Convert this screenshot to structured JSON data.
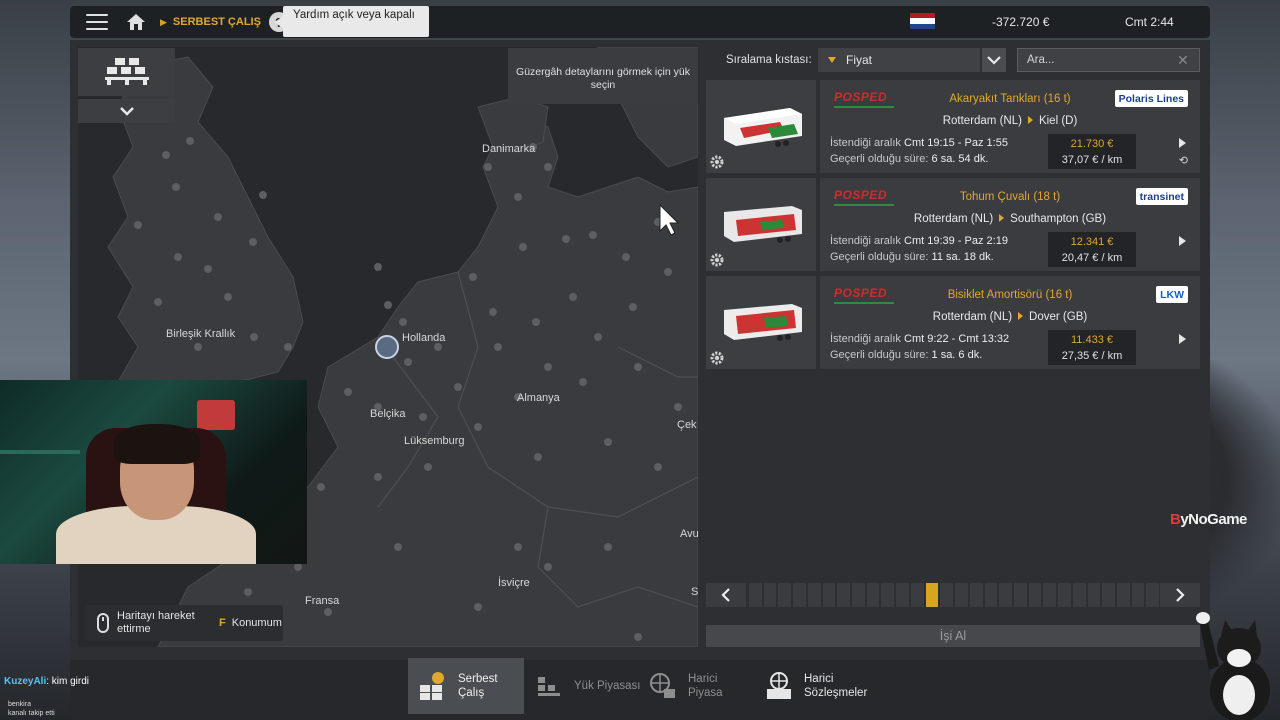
{
  "topbar": {
    "breadcrumb": "SERBEST ÇALIŞ",
    "help_symbol": "?",
    "help_tooltip": "Yardım açık veya kapalı",
    "money": "-372.720 €",
    "time": "Cmt 2:44",
    "flag": [
      "#ae1c28",
      "#ffffff",
      "#21468b"
    ]
  },
  "map": {
    "route_hint": "Güzergâh detaylarını görmek için yük seçin",
    "labels": {
      "denmark": "Danimarka",
      "uk": "Birleşik Krallık",
      "netherlands": "Hollanda",
      "belgium": "Belçika",
      "luxembourg": "Lüksemburg",
      "germany": "Almanya",
      "france": "Fransa",
      "switzerland": "İsviçre",
      "czech": "Çek",
      "austria": "Avu",
      "slovenia": "S"
    },
    "move_hint": "Haritayı hareket ettirme",
    "location_key": "F",
    "location_label": "Konumum"
  },
  "sort": {
    "label": "Sıralama kıstası:",
    "value": "Fiyat",
    "search_placeholder": "Ara..."
  },
  "jobs": [
    {
      "sender": "POSPED",
      "cargo": "Akaryakıt Tankları (16 t)",
      "company": "Polaris Lines",
      "company_color": "#1b3f91",
      "from": "Rotterdam (NL)",
      "to": "Kiel (D)",
      "window_label": "İstendiği aralık",
      "window": "Cmt 19:15 - Paz 1:55",
      "valid_label": "Geçerli olduğu süre:",
      "valid": "6 sa. 54 dk.",
      "price": "21.730 €",
      "rate": "37,07 € / km"
    },
    {
      "sender": "POSPED",
      "cargo": "Tohum Çuvalı (18 t)",
      "company": "transinet",
      "company_color": "#1c3f8c",
      "from": "Rotterdam (NL)",
      "to": "Southampton (GB)",
      "window_label": "İstendiği aralık",
      "window": "Cmt 19:39 - Paz 2:19",
      "valid_label": "Geçerli olduğu süre:",
      "valid": "11 sa. 18 dk.",
      "price": "12.341 €",
      "rate": "20,47 € / km"
    },
    {
      "sender": "POSPED",
      "cargo": "Bisiklet Amortisörü (16 t)",
      "company": "LKW",
      "company_color": "#1a5cc8",
      "from": "Rotterdam (NL)",
      "to": "Dover (GB)",
      "window_label": "İstendiği aralık",
      "window": "Cmt 9:22 - Cmt 13:32",
      "valid_label": "Geçerli olduğu süre:",
      "valid": "1 sa. 6 dk.",
      "price": "11.433 €",
      "rate": "27,35 € / km"
    }
  ],
  "pager": {
    "active_page": 13,
    "total_pages": 28
  },
  "take_job": "İşi Al",
  "tabs": [
    {
      "label": "Serbest\nÇalış",
      "icon": "freelance-icon",
      "active": true
    },
    {
      "label": "Yük Piyasası",
      "icon": "cargo-market-icon",
      "active": false
    },
    {
      "label": "Harici\nPiyasa",
      "icon": "external-market-icon",
      "active": false
    },
    {
      "label": "Harici\nSözleşmeler",
      "icon": "external-contracts-icon",
      "active": false
    }
  ],
  "overlay": {
    "brand_prefix": "B",
    "brand_rest": "yNoGame",
    "chat_user": "KuzeyAli",
    "chat_message": ": kim girdi",
    "follower_name": "benkira",
    "follower_note": "kanalı takip etti"
  }
}
